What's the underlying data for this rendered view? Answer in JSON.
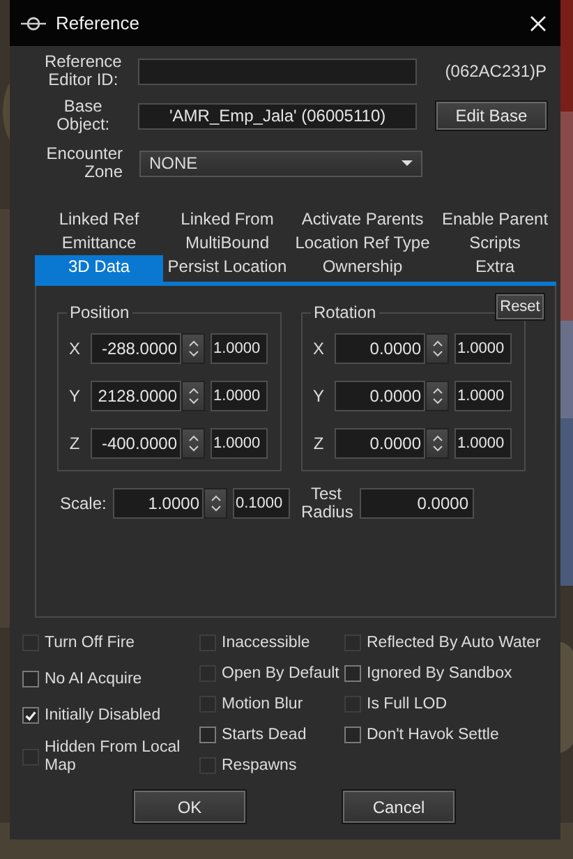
{
  "window": {
    "title": "Reference"
  },
  "reference_editor_id": {
    "label": "Reference Editor ID:"
  },
  "form_id": "(062AC231)P",
  "base_object": {
    "label": "Base Object:",
    "value": "'AMR_Emp_Jala' (06005110)"
  },
  "edit_base_button": "Edit Base",
  "encounter_zone": {
    "label": "Encounter Zone",
    "value": "NONE"
  },
  "tab_rows": [
    [
      {
        "label": "Linked Ref",
        "selected": false
      },
      {
        "label": "Linked From",
        "selected": false
      },
      {
        "label": "Activate Parents",
        "selected": false
      },
      {
        "label": "Enable Parent",
        "selected": false
      }
    ],
    [
      {
        "label": "Emittance",
        "selected": false
      },
      {
        "label": "MultiBound",
        "selected": false
      },
      {
        "label": "Location Ref Type",
        "selected": false
      },
      {
        "label": "Scripts",
        "selected": false
      }
    ],
    [
      {
        "label": "3D Data",
        "selected": true
      },
      {
        "label": "Persist Location",
        "selected": false
      },
      {
        "label": "Ownership",
        "selected": false
      },
      {
        "label": "Extra",
        "selected": false
      }
    ]
  ],
  "groups": [
    {
      "title": "Position",
      "axes": [
        {
          "axis": "X",
          "value": "-288.0000",
          "step": "1.0000"
        },
        {
          "axis": "Y",
          "value": "2128.0000",
          "step": "1.0000"
        },
        {
          "axis": "Z",
          "value": "-400.0000",
          "step": "1.0000"
        }
      ]
    },
    {
      "title": "Rotation",
      "axes": [
        {
          "axis": "X",
          "value": "0.0000",
          "step": "1.0000"
        },
        {
          "axis": "Y",
          "value": "0.0000",
          "step": "1.0000"
        },
        {
          "axis": "Z",
          "value": "0.0000",
          "step": "1.0000"
        }
      ]
    }
  ],
  "reset_button": "Reset",
  "scale": {
    "label": "Scale:",
    "value": "1.0000",
    "step": "0.1000"
  },
  "test_radius": {
    "label": "Test Radius",
    "value": "0.0000"
  },
  "flag_columns": [
    [
      {
        "label": "Turn Off Fire",
        "checked": false,
        "disabled": true
      },
      {
        "label": "No AI Acquire",
        "checked": false,
        "disabled": false
      },
      {
        "label": "Initially Disabled",
        "checked": true,
        "disabled": false
      },
      {
        "label": "Hidden From Local Map",
        "checked": false,
        "disabled": true
      }
    ],
    [
      {
        "label": "Inaccessible",
        "checked": false,
        "disabled": true
      },
      {
        "label": "Open By Default",
        "checked": false,
        "disabled": true
      },
      {
        "label": "Motion Blur",
        "checked": false,
        "disabled": true
      },
      {
        "label": "Starts Dead",
        "checked": false,
        "disabled": false
      },
      {
        "label": "Respawns",
        "checked": false,
        "disabled": true
      }
    ],
    [
      {
        "label": "Reflected By Auto Water",
        "checked": false,
        "disabled": true
      },
      {
        "label": "Ignored By Sandbox",
        "checked": false,
        "disabled": false
      },
      {
        "label": "Is Full LOD",
        "checked": false,
        "disabled": true
      },
      {
        "label": "Don't Havok Settle",
        "checked": false,
        "disabled": false
      }
    ]
  ],
  "buttons": [
    "OK",
    "Cancel"
  ]
}
